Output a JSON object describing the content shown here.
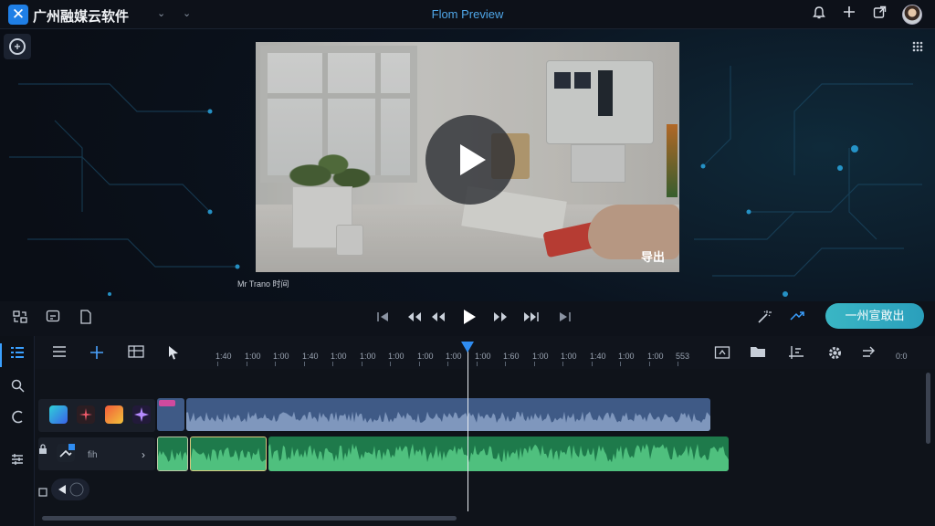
{
  "app": {
    "title": "广州融媒云软件",
    "center_title": "Flom Preview"
  },
  "topbar": {
    "icons": [
      "bell-icon",
      "plus-icon",
      "share-icon"
    ]
  },
  "preview": {
    "export_overlay": "导出",
    "caption": "Mr Trano 时间"
  },
  "transport": {
    "export_button": "一州宣敢出"
  },
  "timeline": {
    "ruler": [
      "1:40",
      "1:00",
      "1:00",
      "1:40",
      "1:00",
      "1:00",
      "1:00",
      "1:00",
      "1:00",
      "1:00",
      "1:60",
      "1:00",
      "1:00",
      "1:40",
      "1:00",
      "1:00",
      "553"
    ],
    "zoom": "0:0",
    "track_label": "fih"
  },
  "colors": {
    "accent": "#2f8cf0",
    "export_button": "#3ab6c4",
    "video_clip": "#3f5a86",
    "audio_clip": "#1e7a4b"
  }
}
